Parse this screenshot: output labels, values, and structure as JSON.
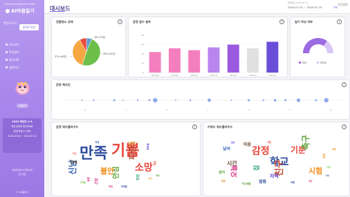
{
  "sidebar": {
    "brand_sub": "Group Management Toolkit",
    "brand": "AI마음일기",
    "semester_label": "학년도·학기",
    "semester_value": "2024 학년",
    "menu": [
      {
        "label": "대시보드"
      },
      {
        "label": "학생관리"
      },
      {
        "label": "일기기록"
      },
      {
        "label": "설정하기"
      }
    ],
    "ghost_btn": "더보기",
    "card_title": "2024 학년도 1-4",
    "card_line1": "학생 정보를 확인하세요",
    "card_line2": "현재 학생 수 28명",
    "card_line3": "2024.03.04 ~ 2024.07.15",
    "footer1": "학생관리를 더 편리하게",
    "footer2": "로그아웃",
    "footer3": "© AI마음일기"
  },
  "topbar": {
    "title": "대시보드",
    "updated": "업데이트 2024.07.15",
    "date_range": "2024-07-01 ~ 2024-07-15",
    "date_btn": "조회",
    "init_btn": "기간설정"
  },
  "cards": {
    "emotion_ratio": "연말청소 상태",
    "emotion_dist": "감정 점수 분포",
    "diary_write": "일기 작성 여부",
    "emotion_check": "감정 체크인",
    "emotion_wc": "감정 워드클라우드",
    "keyword_wc": "키워드 워드클라우드"
  },
  "pie": {
    "colors": [
      "#5b9bd5",
      "#6cc04a",
      "#f4a742",
      "#e84b3c"
    ],
    "labels": [
      {
        "text": "8% (12건)"
      },
      {
        "text": "49% (61건)"
      },
      {
        "text": "37% (46건)"
      }
    ]
  },
  "bars": {
    "colors": [
      "#f47fbf",
      "#f47fbf",
      "#f47fbf",
      "#b985ee",
      "#9b59e0",
      "#e0e0e0",
      "#6a4ed8"
    ],
    "values": [
      22,
      26,
      24,
      27,
      30,
      26,
      33
    ],
    "ylim": [
      0,
      40
    ],
    "yticks": [
      "40",
      "30",
      "20",
      "10",
      "0"
    ],
    "xticks": [
      "2024-06",
      "2024-06",
      "2024-07",
      "2024-07",
      "2024-07",
      "2024-07",
      "2024-07"
    ]
  },
  "gauge": {
    "fraction": 0.7,
    "color_on": "#9b6be0",
    "color_off": "#d9c8f4",
    "legend": [
      {
        "label": "작성",
        "color": "#9b6be0"
      },
      {
        "label": "미작성",
        "color": "#d9c8f4"
      }
    ]
  },
  "timeline": {
    "xticks": [
      "0",
      "1",
      "2",
      "3",
      "4",
      "5",
      "6"
    ],
    "dots": [
      {
        "x": 0.7,
        "r": 1
      },
      {
        "x": 1.1,
        "r": 1.2
      },
      {
        "x": 1.8,
        "r": 1.5
      },
      {
        "x": 2.1,
        "r": 1
      },
      {
        "x": 2.6,
        "r": 1.2
      },
      {
        "x": 3.0,
        "r": 1.4
      },
      {
        "x": 3.2,
        "r": 3.2
      },
      {
        "x": 3.9,
        "r": 1
      },
      {
        "x": 4.4,
        "r": 1.3
      },
      {
        "x": 5.05,
        "r": 2.4
      },
      {
        "x": 5.8,
        "r": 1
      },
      {
        "x": 6.4,
        "r": 1.6
      },
      {
        "x": 6.9,
        "r": 1.3
      },
      {
        "x": 7.3,
        "r": 1.8
      },
      {
        "x": 7.65,
        "r": 1.5
      },
      {
        "x": 8.1,
        "r": 2.6
      },
      {
        "x": 8.7,
        "r": 1.4
      },
      {
        "x": 9.05,
        "r": 3.2
      }
    ],
    "xlim": [
      0,
      9.6
    ],
    "dot_color": "#7b9be8"
  },
  "wc_emotion": [
    {
      "t": "만족",
      "size": 22,
      "c": "#2c4c9c"
    },
    {
      "t": "기쁨",
      "size": 22,
      "c": "#e8463c"
    },
    {
      "t": "소망",
      "size": 14,
      "c": "#e8463c"
    },
    {
      "t": "짜증",
      "size": 11,
      "c": "#c2412b"
    },
    {
      "t": "불안",
      "size": 11,
      "c": "#f08c1a"
    },
    {
      "t": "안심",
      "size": 10,
      "c": "#5da33a"
    },
    {
      "t": "신남",
      "size": 12,
      "c": "#3a68b6"
    },
    {
      "t": "실망",
      "size": 6,
      "c": "#d08c2a"
    },
    {
      "t": "감사",
      "size": 6,
      "c": "#6a4a33"
    },
    {
      "t": "긴장",
      "size": 5,
      "c": "#d6368a"
    },
    {
      "t": "희망",
      "size": 5,
      "c": "#3aa67a"
    },
    {
      "t": "외로움",
      "size": 3.5,
      "c": "#5d3dd6"
    },
    {
      "t": "걱정",
      "size": 3.5,
      "c": "#3a68b6"
    },
    {
      "t": "평온",
      "size": 3.5,
      "c": "#e8463c"
    },
    {
      "t": "그리움",
      "size": 3.2,
      "c": "#6cc04a"
    },
    {
      "t": "후회",
      "size": 3.2,
      "c": "#d6368a"
    },
    {
      "t": "두려움",
      "size": 3.2,
      "c": "#2c4c9c"
    },
    {
      "t": "분노",
      "size": 3,
      "c": "#f08c1a"
    },
    {
      "t": "설렘",
      "size": 3.6,
      "c": "#d6368a"
    },
    {
      "t": "자랑",
      "size": 3,
      "c": "#5da33a"
    },
    {
      "t": "피곤",
      "size": 3,
      "c": "#e8463c"
    }
  ],
  "wc_keyword": [
    {
      "t": "학교",
      "size": 15,
      "c": "#2c4c9c"
    },
    {
      "t": "감정",
      "size": 14,
      "c": "#e8463c"
    },
    {
      "t": "기분",
      "size": 12,
      "c": "#e8463c"
    },
    {
      "t": "축구",
      "size": 12,
      "c": "#5da33a"
    },
    {
      "t": "시험",
      "size": 11,
      "c": "#f08c1a"
    },
    {
      "t": "친구",
      "size": 13,
      "c": "#c2412b"
    },
    {
      "t": "시간",
      "size": 8,
      "c": "#6a4a33"
    },
    {
      "t": "날씨",
      "size": 6,
      "c": "#3a68b6"
    },
    {
      "t": "마음",
      "size": 6,
      "c": "#6a4a33"
    },
    {
      "t": "저녁",
      "size": 7,
      "c": "#5d3dd6"
    },
    {
      "t": "영화",
      "size": 6,
      "c": "#2c4c9c"
    },
    {
      "t": "생각",
      "size": 5,
      "c": "#5da33a"
    },
    {
      "t": "오늘",
      "size": 10,
      "c": "#d6368a"
    },
    {
      "t": "집",
      "size": 9,
      "c": "#3aa67a"
    },
    {
      "t": "피곤",
      "size": 4,
      "c": "#f08c1a"
    },
    {
      "t": "학교생활",
      "size": 3.4,
      "c": "#5da33a"
    },
    {
      "t": "운동",
      "size": 3.2,
      "c": "#d08c2a"
    },
    {
      "t": "아침",
      "size": 3.2,
      "c": "#e8463c"
    },
    {
      "t": "숙제",
      "size": 3.2,
      "c": "#2c4c9c"
    },
    {
      "t": "게임",
      "size": 3,
      "c": "#d6368a"
    },
    {
      "t": "가족",
      "size": 3,
      "c": "#6cc04a"
    },
    {
      "t": "기대",
      "size": 3,
      "c": "#3a68b6"
    },
    {
      "t": "점심",
      "size": 3,
      "c": "#5d3dd6"
    },
    {
      "t": "여행",
      "size": 3,
      "c": "#f08c1a"
    }
  ]
}
